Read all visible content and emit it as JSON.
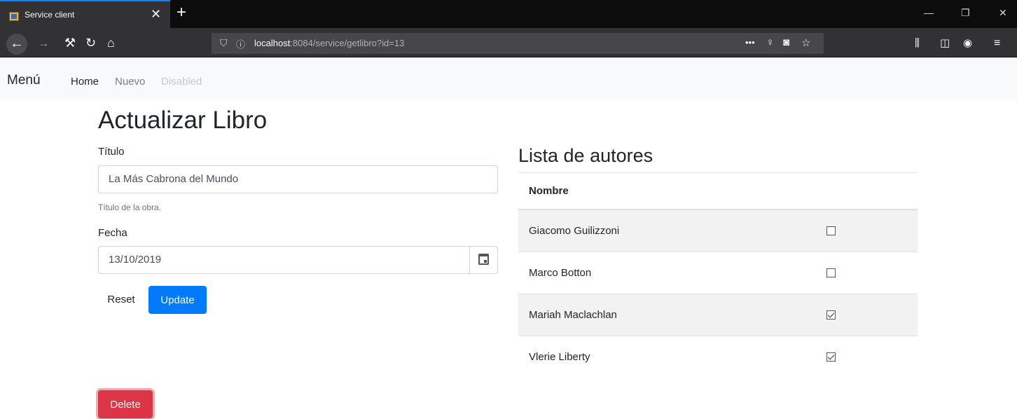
{
  "browser": {
    "tab_title": "Service client",
    "tab_close": "✕",
    "new_tab": "+",
    "url_host": "localhost",
    "url_rest": ":8084/service/getlibro?id=13",
    "page_actions": "•••"
  },
  "nav": {
    "brand": "Menú",
    "links": [
      {
        "label": "Home",
        "color": "#212529"
      },
      {
        "label": "Nuevo",
        "color": "#7d7d7d"
      },
      {
        "label": "Disabled",
        "color": "#c8c8c8"
      }
    ]
  },
  "form": {
    "heading": "Actualizar Libro",
    "titulo_label": "Título",
    "titulo_value": "La Más Cabrona del Mundo",
    "titulo_help": "Título de la obra.",
    "fecha_label": "Fecha",
    "fecha_value": "13/10/2019",
    "reset_label": "Reset",
    "update_label": "Update",
    "delete_label": "Delete"
  },
  "authors": {
    "title": "Lista de autores",
    "header_name": "Nombre",
    "rows": [
      {
        "name": "Giacomo Guilizzoni",
        "checked": false
      },
      {
        "name": "Marco Botton",
        "checked": false
      },
      {
        "name": "Mariah Maclachlan",
        "checked": true
      },
      {
        "name": "Vlerie Liberty",
        "checked": true
      }
    ]
  },
  "colors": {
    "primary": "#007bff",
    "danger": "#dc3545",
    "tab_accent": "#0a84ff"
  }
}
